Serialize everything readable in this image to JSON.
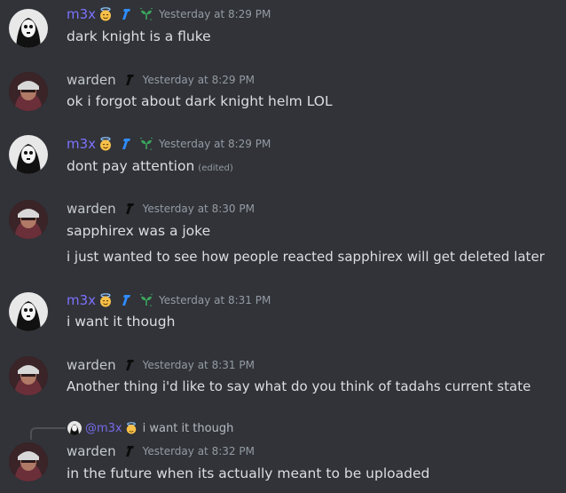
{
  "messages": [
    {
      "user": "m3x",
      "timestamp": "Yesterday at 8:29 PM",
      "lines": [
        "dark knight is a fluke"
      ]
    },
    {
      "user": "warden",
      "timestamp": "Yesterday at 8:29 PM",
      "lines": [
        "ok i forgot about dark knight helm LOL"
      ]
    },
    {
      "user": "m3x",
      "timestamp": "Yesterday at 8:29 PM",
      "lines": [
        "dont pay attention"
      ],
      "edited": "(edited)"
    },
    {
      "user": "warden",
      "timestamp": "Yesterday at 8:30 PM",
      "lines": [
        "sapphirex was a joke",
        "i just wanted to see how people reacted sapphirex will get deleted later"
      ]
    },
    {
      "user": "m3x",
      "timestamp": "Yesterday at 8:31 PM",
      "lines": [
        "i want it though"
      ]
    },
    {
      "user": "warden",
      "timestamp": "Yesterday at 8:31 PM",
      "lines": [
        "Another thing i'd like to say what do you think of tadahs current state"
      ]
    },
    {
      "user": "warden",
      "timestamp": "Yesterday at 8:32 PM",
      "lines": [
        "in the future when its actually meant to be uploaded"
      ],
      "reply": {
        "name": "@m3x",
        "text": "i want it though"
      }
    }
  ],
  "colors": {
    "background": "#313338",
    "m3x_name": "#7d72ff",
    "warden_name": "#c4c9ce",
    "timestamp": "#949ba4",
    "text": "#dbdee1"
  },
  "icons": {
    "m3x_badges": [
      "angel-emoji-icon",
      "blue-tool-icon",
      "green-sprout-icon"
    ],
    "warden_badges": [
      "black-tool-icon"
    ]
  }
}
